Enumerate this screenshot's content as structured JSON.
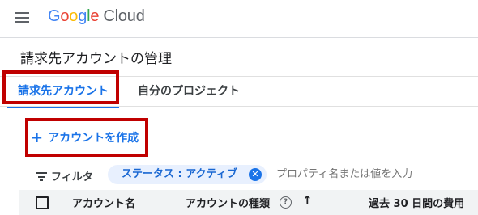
{
  "header": {
    "logo_google": [
      "G",
      "o",
      "o",
      "g",
      "l",
      "e"
    ],
    "logo_colors": [
      "#4285F4",
      "#EA4335",
      "#FBBC05",
      "#4285F4",
      "#34A853",
      "#EA4335"
    ],
    "logo_cloud": "Cloud"
  },
  "page": {
    "title": "請求先アカウントの管理"
  },
  "tabs": [
    {
      "label": "請求先アカウント",
      "active": true
    },
    {
      "label": "自分のプロジェクト",
      "active": false
    }
  ],
  "actions": {
    "create_account": "アカウントを作成",
    "create_icon": "+"
  },
  "filter": {
    "label": "フィルタ",
    "chip": "ステータス : アクティブ",
    "placeholder": "プロパティ名または値を入力"
  },
  "table": {
    "columns": {
      "name": "アカウント名",
      "type": "アカウントの種類",
      "cost": "過去 30 日間の費用"
    },
    "sort_icon": "↑"
  },
  "accent_color": "#1a73e8",
  "highlight_color": "#c00000"
}
